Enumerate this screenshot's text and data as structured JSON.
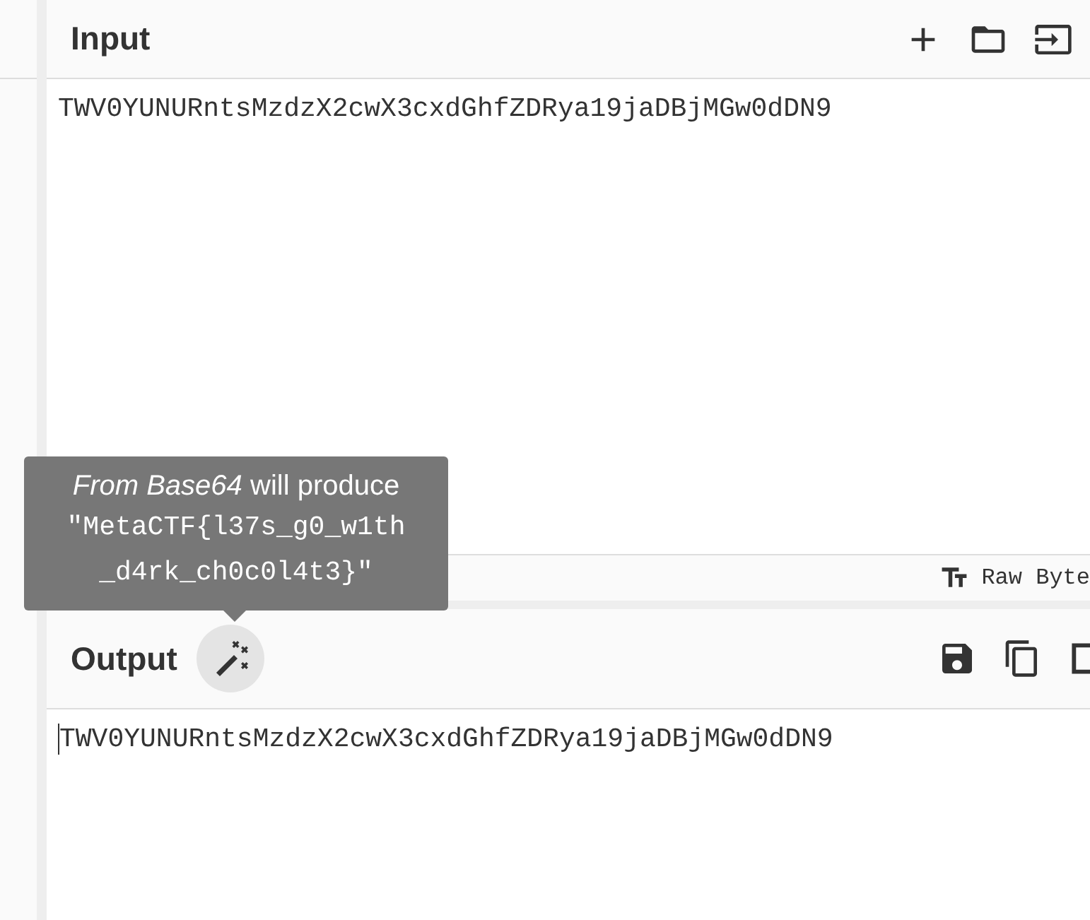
{
  "input": {
    "title": "Input",
    "text": "TWV0YUNURntsMzdzX2cwX3cxdGhfZDRya19jaDBjMGw0dDN9",
    "status": {
      "encoding": "Raw Byte"
    }
  },
  "output": {
    "title": "Output",
    "text": "TWV0YUNURntsMzdzX2cwX3cxdGhfZDRya19jaDBjMGw0dDN9"
  },
  "tooltip": {
    "caption": "*From Base64* will produce",
    "result": "\"MetaCTF{l37s_g0_w1th_d4rk_ch0c0l4t3}\""
  }
}
